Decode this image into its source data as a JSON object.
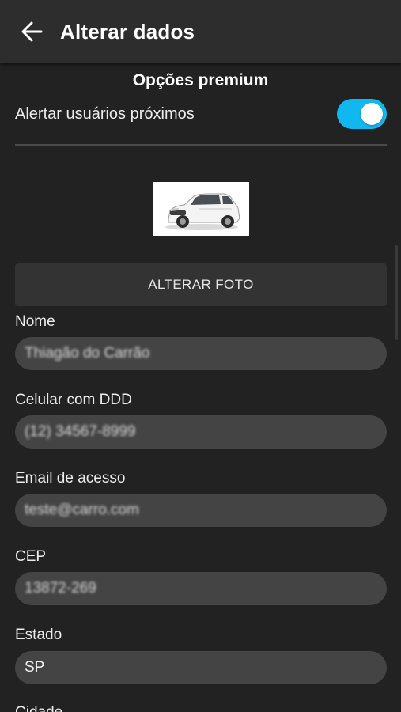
{
  "header": {
    "title": "Alterar dados"
  },
  "premium": {
    "title": "Opções premium",
    "alert_label": "Alertar usuários próximos",
    "alert_enabled": true
  },
  "photo": {
    "button_label": "ALTERAR FOTO"
  },
  "form": {
    "name": {
      "label": "Nome",
      "value": "Thiagão do Carrão"
    },
    "phone": {
      "label": "Celular com DDD",
      "value": "(12) 34567-8999"
    },
    "email": {
      "label": "Email de acesso",
      "value": "teste@carro.com"
    },
    "cep": {
      "label": "CEP",
      "value": "13872-269"
    },
    "state": {
      "label": "Estado",
      "value": "SP"
    },
    "city": {
      "label": "Cidade"
    }
  },
  "colors": {
    "accent": "#11b8f0",
    "background": "#222222",
    "appbar": "#2d2d2d",
    "input": "#444444"
  }
}
